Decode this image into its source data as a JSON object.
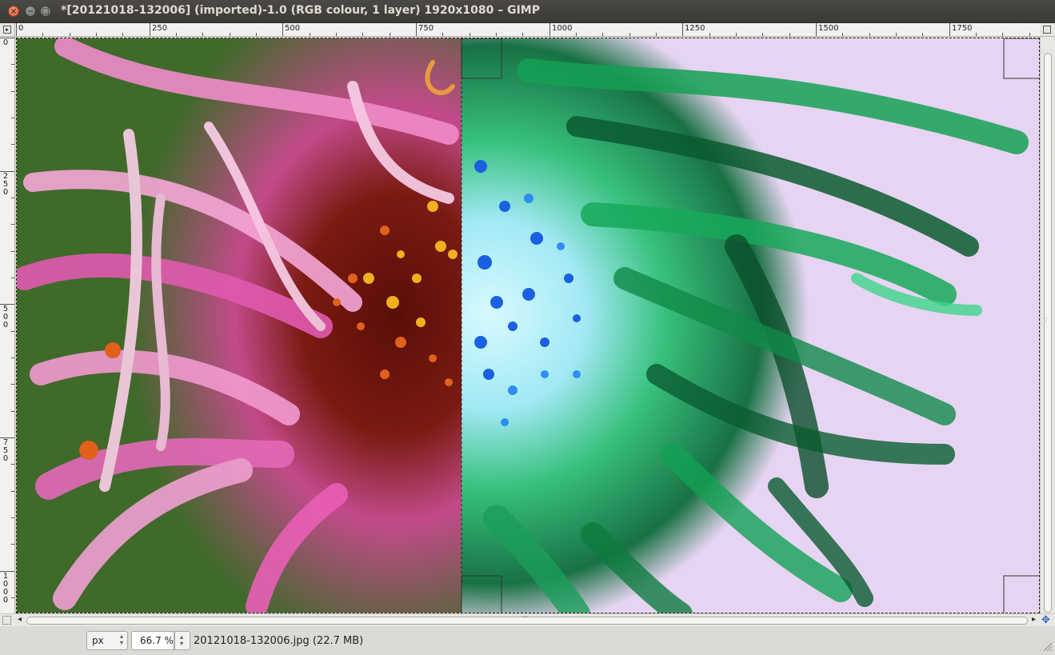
{
  "window": {
    "title": "*[20121018-132006] (imported)-1.0 (RGB colour, 1 layer) 1920x1080 – GIMP",
    "controls": {
      "close": "×",
      "minimize": "−",
      "maximize": "□"
    }
  },
  "rulers": {
    "horizontal_labels": [
      "0",
      "250",
      "500",
      "750",
      "1000",
      "1250",
      "1500",
      "1750"
    ],
    "vertical_labels": [
      "0",
      "250",
      "500",
      "750",
      "1000"
    ]
  },
  "canvas": {
    "image_size": "1920x1080",
    "description_colors": {
      "original_background": "#3f6a2a",
      "original_petals": "#e468b8",
      "original_center": "#7a1b12",
      "inverted_background": "#e7d4f2",
      "inverted_petals": "#1fae5e",
      "inverted_center": "#b9f3ff"
    }
  },
  "status": {
    "unit": "px",
    "zoom": "66.7 %",
    "file_info": "20121018-132006.jpg (22.7 MB)"
  }
}
